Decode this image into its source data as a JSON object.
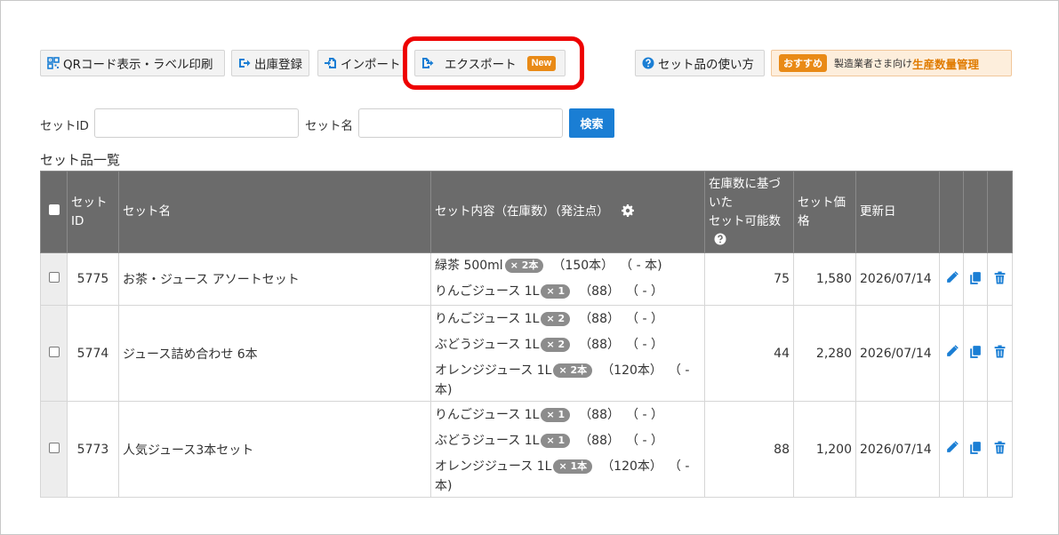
{
  "toolbar": {
    "qr_label": "QRコード表示・ラベル印刷",
    "shipping_label": "出庫登録",
    "import_label": "インポート",
    "export_label": "エクスポート",
    "export_badge": "New",
    "howto_label": "セット品の使い方",
    "promo_badge": "おすすめ",
    "promo_text": "製造業者さま向け",
    "promo_accent": "生産数量管理"
  },
  "search": {
    "set_id_label": "セットID",
    "set_id_value": "",
    "set_name_label": "セット名",
    "set_name_value": "",
    "button_label": "検索"
  },
  "list": {
    "title": "セット品一覧",
    "columns": {
      "set_id": "セット\nID",
      "set_name": "セット名",
      "contents": "セット内容（在庫数）（発注点）",
      "possible": "在庫数に基づいた\nセット可能数",
      "price": "セット価格",
      "updated": "更新日"
    },
    "rows": [
      {
        "id": "5775",
        "name": "お茶・ジュース アソートセット",
        "items": [
          {
            "name": "緑茶 500ml",
            "qty": "× 2本",
            "stock": "（150本）",
            "order": "（ - 本)"
          },
          {
            "name": "りんごジュース 1L",
            "qty": "× 1",
            "stock": "（88）",
            "order": "（ - ）"
          }
        ],
        "possible": "75",
        "price": "1,580",
        "updated": "2026/07/14"
      },
      {
        "id": "5774",
        "name": "ジュース詰め合わせ 6本",
        "items": [
          {
            "name": "りんごジュース 1L",
            "qty": "× 2",
            "stock": "（88）",
            "order": "（ - ）"
          },
          {
            "name": "ぶどうジュース 1L",
            "qty": "× 2",
            "stock": "（88）",
            "order": "（ - ）"
          },
          {
            "name": "オレンジジュース 1L",
            "qty": "× 2本",
            "stock": "（120本）",
            "order": "（ - 本)"
          }
        ],
        "possible": "44",
        "price": "2,280",
        "updated": "2026/07/14"
      },
      {
        "id": "5773",
        "name": "人気ジュース3本セット",
        "items": [
          {
            "name": "りんごジュース 1L",
            "qty": "× 1",
            "stock": "（88）",
            "order": "（ - ）"
          },
          {
            "name": "ぶどうジュース 1L",
            "qty": "× 1",
            "stock": "（88）",
            "order": "（ - ）"
          },
          {
            "name": "オレンジジュース 1L",
            "qty": "× 1本",
            "stock": "（120本）",
            "order": "（ - 本)"
          }
        ],
        "possible": "88",
        "price": "1,200",
        "updated": "2026/07/14"
      }
    ]
  },
  "icons": {
    "qr": "qr-icon",
    "shipping": "sign-out-icon",
    "import": "file-import-icon",
    "export": "file-export-icon",
    "help": "question-circle-icon",
    "settings": "gear-icon",
    "edit": "pencil-icon",
    "copy": "copy-icon",
    "delete": "trash-icon"
  },
  "colors": {
    "accent": "#1a7ed4",
    "badge": "#e98a16",
    "highlight": "#ee0000",
    "header": "#6b6b6b"
  }
}
